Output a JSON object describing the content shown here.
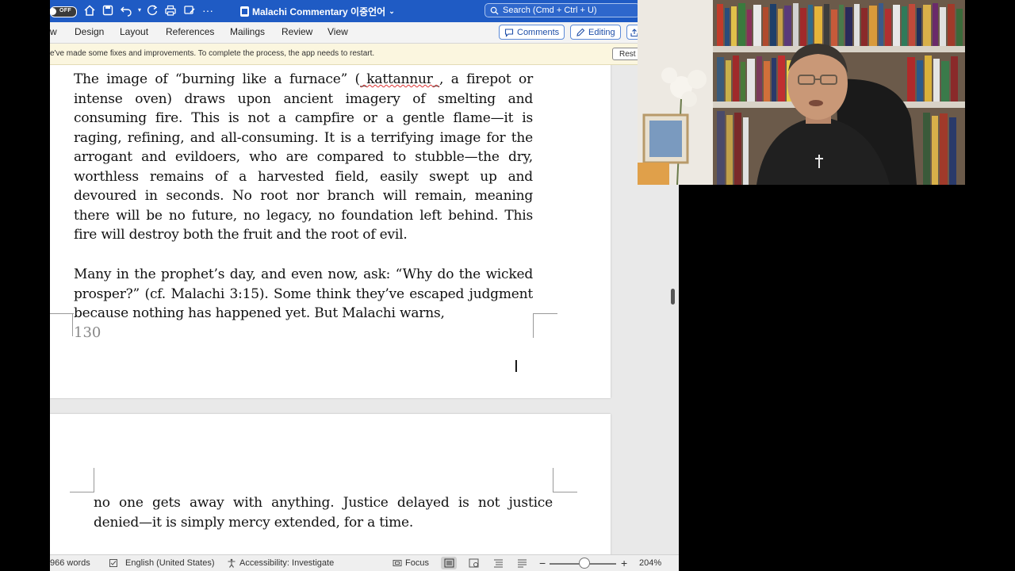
{
  "titlebar": {
    "autosave_label": "OFF",
    "doc_title": "Malachi Commentary 이중언어",
    "search_placeholder": "Search (Cmd + Ctrl + U)"
  },
  "ribbon": {
    "tabs": [
      "w",
      "Design",
      "Layout",
      "References",
      "Mailings",
      "Review",
      "View"
    ],
    "comments_label": "Comments",
    "editing_label": "Editing"
  },
  "message_bar": {
    "text": "e've made some fixes and improvements. To complete the process, the app needs to restart.",
    "button_label": "Rest"
  },
  "document": {
    "page1_para1_before": "The image of “burning like a furnace” (",
    "page1_para1_word": "_kattannur_",
    "page1_para1_after": ", a firepot or intense oven) draws upon ancient imagery of smelting and consuming fire. This is not a campfire or a gentle flame—it is raging, refining, and all-consuming. It is a terrifying image for the arrogant and evildoers, who are compared to stubble—the dry, worthless remains of a harvested field, easily swept up and devoured in seconds. No root nor branch will remain, meaning there will be no future, no legacy, no foundation left behind. This fire will destroy both the fruit and the root of evil.",
    "page1_para2": "Many in the prophet’s day, and even now, ask: “Why do the wicked prosper?” (cf. Malachi 3:15). Some think they’ve escaped judgment because nothing has happened yet. But Malachi warns,",
    "page_number": "130",
    "page2_para1": "no one gets away with anything. Justice delayed is not justice denied—it is simply mercy extended, for a time."
  },
  "statusbar": {
    "word_count": "966 words",
    "language": "English (United States)",
    "accessibility": "Accessibility: Investigate",
    "focus": "Focus",
    "zoom_level": "204%",
    "zoom_fraction": 0.52
  },
  "colors": {
    "titlebar_bg": "#1f5bc4",
    "ribbon_bg": "#f3f3f3",
    "message_bar_bg": "#fbf6df",
    "canvas_bg": "#e9e9e9"
  }
}
